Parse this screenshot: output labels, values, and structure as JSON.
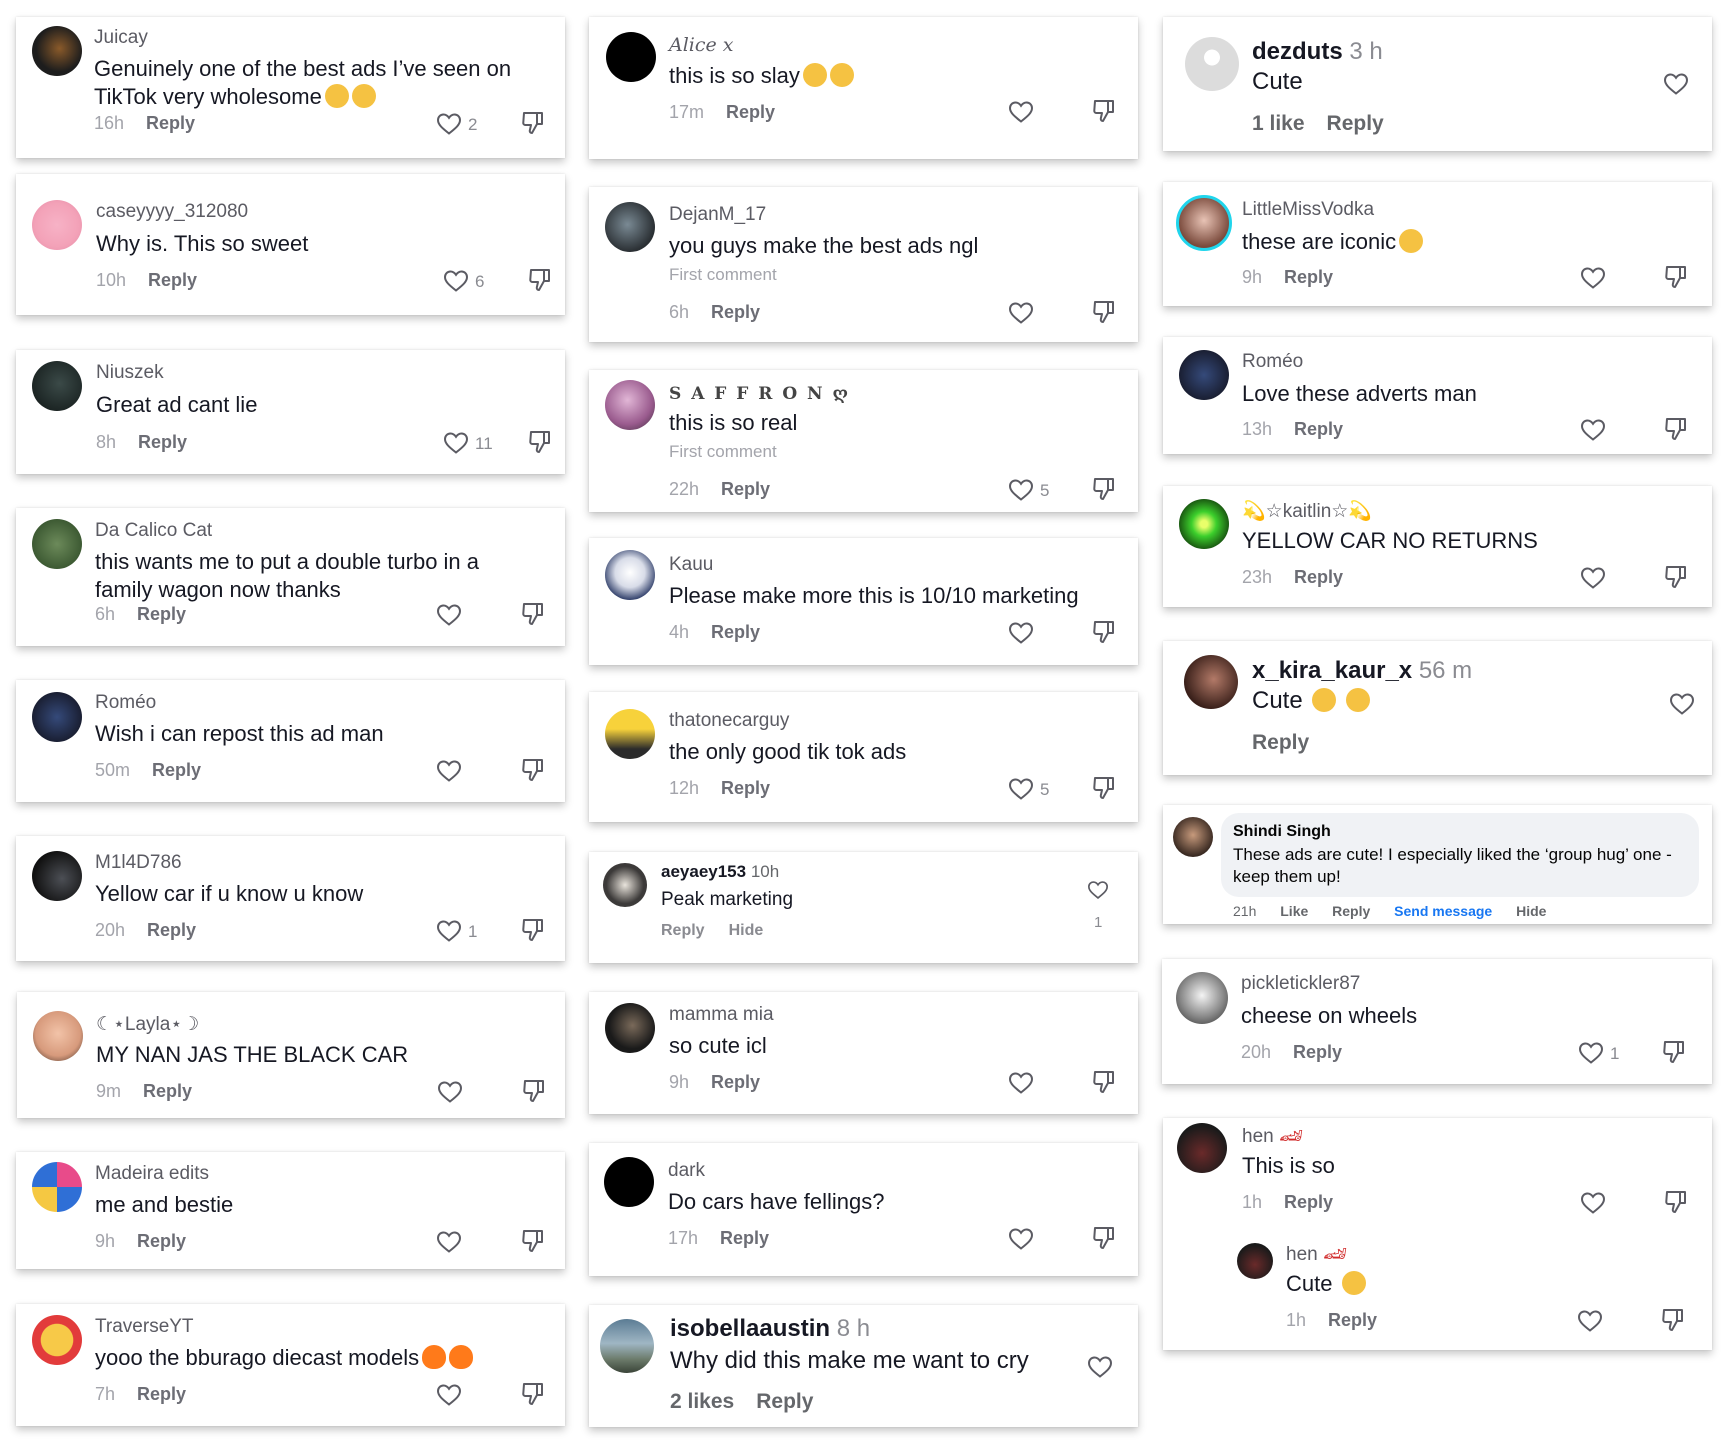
{
  "col1": [
    {
      "user": "Juicay",
      "text": "Genuinely one of the best ads I’ve seen on TikTok very wholesome",
      "time": "16h",
      "reply": "Reply",
      "likes": "2"
    },
    {
      "user": "caseyyyy_312080",
      "text": "Why is. This so sweet",
      "time": "10h",
      "reply": "Reply",
      "likes": "6"
    },
    {
      "user": "Niuszek",
      "text": "Great ad cant lie",
      "time": "8h",
      "reply": "Reply",
      "likes": "11"
    },
    {
      "user": "Da Calico Cat",
      "text": "this wants me to put a double turbo in a family wagon now thanks",
      "time": "6h",
      "reply": "Reply",
      "likes": ""
    },
    {
      "user": "Roméo",
      "text": "Wish i can repost this ad man",
      "time": "50m",
      "reply": "Reply",
      "likes": ""
    },
    {
      "user": "M1l4D786",
      "text": "Yellow car if u know u know",
      "time": "20h",
      "reply": "Reply",
      "likes": "1"
    },
    {
      "user": "☾⋆Layla⋆☽",
      "text": "MY NAN JAS THE BLACK CAR",
      "time": "9m",
      "reply": "Reply",
      "likes": ""
    },
    {
      "user": "Madeira edits",
      "text": "me and bestie",
      "time": "9h",
      "reply": "Reply",
      "likes": ""
    },
    {
      "user": "TraverseYT",
      "text": "yooo the bburago diecast models",
      "time": "7h",
      "reply": "Reply",
      "likes": ""
    }
  ],
  "col2": [
    {
      "user": "Alice x",
      "text": "this is so slay",
      "time": "17m",
      "reply": "Reply",
      "likes": ""
    },
    {
      "user": "DejanM_17",
      "text": "you guys make the best ads ngl",
      "sub": "First comment",
      "time": "6h",
      "reply": "Reply",
      "likes": ""
    },
    {
      "user": "S A F F R O N ღ",
      "text": "this is so real",
      "sub": "First comment",
      "time": "22h",
      "reply": "Reply",
      "likes": "5"
    },
    {
      "user": "Kauu",
      "text": "Please make more this is 10/10 marketing",
      "time": "4h",
      "reply": "Reply",
      "likes": ""
    },
    {
      "user": "thatonecarguy",
      "text": "the only good tik tok ads",
      "time": "12h",
      "reply": "Reply",
      "likes": "5"
    },
    {
      "user": "aeyaey153",
      "time_inline": "10h",
      "text": "Peak marketing",
      "reply": "Reply",
      "hide": "Hide",
      "likes": "1"
    },
    {
      "user": "mamma mia",
      "text": "so cute icl",
      "time": "9h",
      "reply": "Reply",
      "likes": ""
    },
    {
      "user": "dark",
      "text": "Do cars have fellings?",
      "time": "17h",
      "reply": "Reply",
      "likes": ""
    },
    {
      "user": "isobellaaustin",
      "time_inline": "8 h",
      "text": "Why did this make me want to cry",
      "likes_text": "2 likes",
      "reply": "Reply"
    }
  ],
  "col3": [
    {
      "user": "dezduts",
      "time_inline": "3 h",
      "text": "Cute",
      "likes_text": "1 like",
      "reply": "Reply"
    },
    {
      "user": "LittleMissVodka",
      "text": "these are iconic",
      "time": "9h",
      "reply": "Reply",
      "likes": ""
    },
    {
      "user": "Roméo",
      "text": "Love these adverts man",
      "time": "13h",
      "reply": "Reply",
      "likes": ""
    },
    {
      "user": "💫☆kaitlin☆💫",
      "text": "YELLOW CAR NO RETURNS",
      "time": "23h",
      "reply": "Reply",
      "likes": ""
    },
    {
      "user": "x_kira_kaur_x",
      "time_inline": "56 m",
      "text": "Cute",
      "reply": "Reply"
    },
    {
      "user": "Shindi Singh",
      "text": "These ads are cute! I especially liked the ‘group hug’ one - keep them up!",
      "time": "21h",
      "like": "Like",
      "reply": "Reply",
      "send": "Send message",
      "hide": "Hide"
    },
    {
      "user": "pickletickler87",
      "text": "cheese on wheels",
      "time": "20h",
      "reply": "Reply",
      "likes": "1"
    },
    {
      "user": "hen",
      "text": "This is so",
      "time": "1h",
      "reply": "Reply",
      "likes": ""
    },
    {
      "user": "hen",
      "text": "Cute",
      "time": "1h",
      "reply": "Reply",
      "likes": ""
    }
  ],
  "colors": {
    "text": "#161823",
    "muted": "#a3a4ab",
    "link_blue": "#1877f2"
  }
}
